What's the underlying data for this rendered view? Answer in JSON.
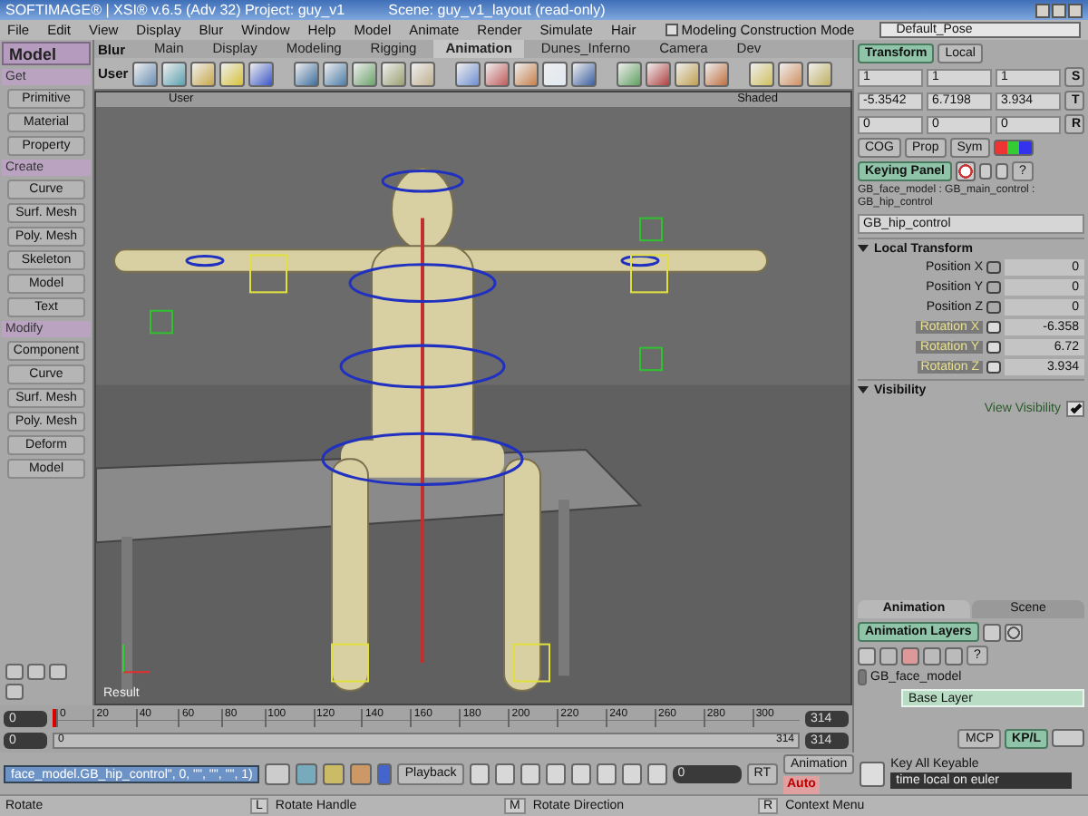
{
  "window": {
    "title": "SOFTIMAGE® | XSI® v.6.5 (Adv 32) Project: guy_v1",
    "scene": "Scene: guy_v1_layout (read-only)"
  },
  "menu": [
    "File",
    "Edit",
    "View",
    "Display",
    "Blur",
    "Window",
    "Help",
    "Model",
    "Animate",
    "Render",
    "Simulate",
    "Hair"
  ],
  "construction_mode": {
    "label": "Modeling Construction Mode",
    "checked": false
  },
  "pose_dropdown": "Default_Pose",
  "module_dropdown": "Model",
  "shelf": {
    "label": "Blur",
    "row_label": "User",
    "tabs": [
      {
        "label": "Main",
        "selected": false
      },
      {
        "label": "Display",
        "selected": false
      },
      {
        "label": "Modeling",
        "selected": false
      },
      {
        "label": "Rigging",
        "selected": false
      },
      {
        "label": "Animation",
        "selected": true
      },
      {
        "label": "Dunes_Inferno",
        "selected": false
      },
      {
        "label": "Camera",
        "selected": false
      },
      {
        "label": "Dev",
        "selected": false
      }
    ]
  },
  "left_panel": {
    "sections": [
      {
        "title": "Get",
        "buttons": [
          "Primitive",
          "Material",
          "Property"
        ]
      },
      {
        "title": "Create",
        "buttons": [
          "Curve",
          "Surf. Mesh",
          "Poly. Mesh",
          "Skeleton",
          "Model",
          "Text"
        ]
      },
      {
        "title": "Modify",
        "buttons": [
          "Component",
          "Curve",
          "Surf. Mesh",
          "Poly. Mesh",
          "Deform",
          "Model"
        ]
      }
    ]
  },
  "viewport": {
    "camera": "User",
    "mode": "Shaded",
    "pass": "Result"
  },
  "transform": {
    "tabs": [
      {
        "label": "Transform",
        "selected": true
      }
    ],
    "space": "Local",
    "rows": [
      {
        "values": [
          "1",
          "1",
          "1"
        ],
        "key": "S"
      },
      {
        "values": [
          "-5.3542",
          "6.7198",
          "3.934"
        ],
        "key": "T"
      },
      {
        "values": [
          "0",
          "0",
          "0"
        ],
        "key": "R"
      }
    ],
    "buttons": [
      "COG",
      "Prop",
      "Sym"
    ]
  },
  "keying": {
    "button": "Keying Panel",
    "help": "?",
    "path": "GB_face_model : GB_main_control : GB_hip_control",
    "object": "GB_hip_control"
  },
  "sections": [
    {
      "title": "Local Transform",
      "expanded": true,
      "params": [
        {
          "label": "Position X",
          "value": "0",
          "animated": false
        },
        {
          "label": "Position Y",
          "value": "0",
          "animated": false
        },
        {
          "label": "Position Z",
          "value": "0",
          "animated": false
        },
        {
          "label": "Rotation X",
          "value": "-6.358",
          "animated": true
        },
        {
          "label": "Rotation Y",
          "value": "6.72",
          "animated": true
        },
        {
          "label": "Rotation Z",
          "value": "3.934",
          "animated": true
        }
      ]
    },
    {
      "title": "Visibility",
      "expanded": true,
      "checks": [
        {
          "label": "View Visibility",
          "checked": true
        }
      ]
    }
  ],
  "lower_tabs": [
    {
      "label": "Animation",
      "selected": true
    },
    {
      "label": "Scene",
      "selected": false
    }
  ],
  "layers": {
    "button": "Animation Layers",
    "help": "?",
    "model": "GB_face_model",
    "items": [
      {
        "label": "Base Layer",
        "selected": true
      }
    ]
  },
  "timeline": {
    "start": "0",
    "end": "314",
    "ticks": [
      "0",
      "20",
      "40",
      "60",
      "80",
      "100",
      "120",
      "140",
      "160",
      "180",
      "200",
      "220",
      "240",
      "260",
      "280",
      "300"
    ],
    "range": {
      "start": "0",
      "min": "0",
      "max": "314",
      "end": "314",
      "level": 1
    }
  },
  "command": {
    "text": "face_model.GB_hip_control\", 0, \"\", \"\", \"\", 1)",
    "playback": "Playback",
    "frame": "0",
    "rt": "RT",
    "animation": "Animation",
    "auto": "Auto",
    "key_all": "Key All Keyable",
    "key_mode": "time local on euler"
  },
  "mcp_tabs": [
    {
      "label": "MCP",
      "selected": false
    },
    {
      "label": "KP/L",
      "selected": true
    }
  ],
  "status_bar": {
    "tool": "Rotate",
    "hints": [
      {
        "key": "L",
        "label": "Rotate Handle"
      },
      {
        "key": "M",
        "label": "Rotate Direction"
      },
      {
        "key": "R",
        "label": "Context Menu"
      }
    ]
  }
}
